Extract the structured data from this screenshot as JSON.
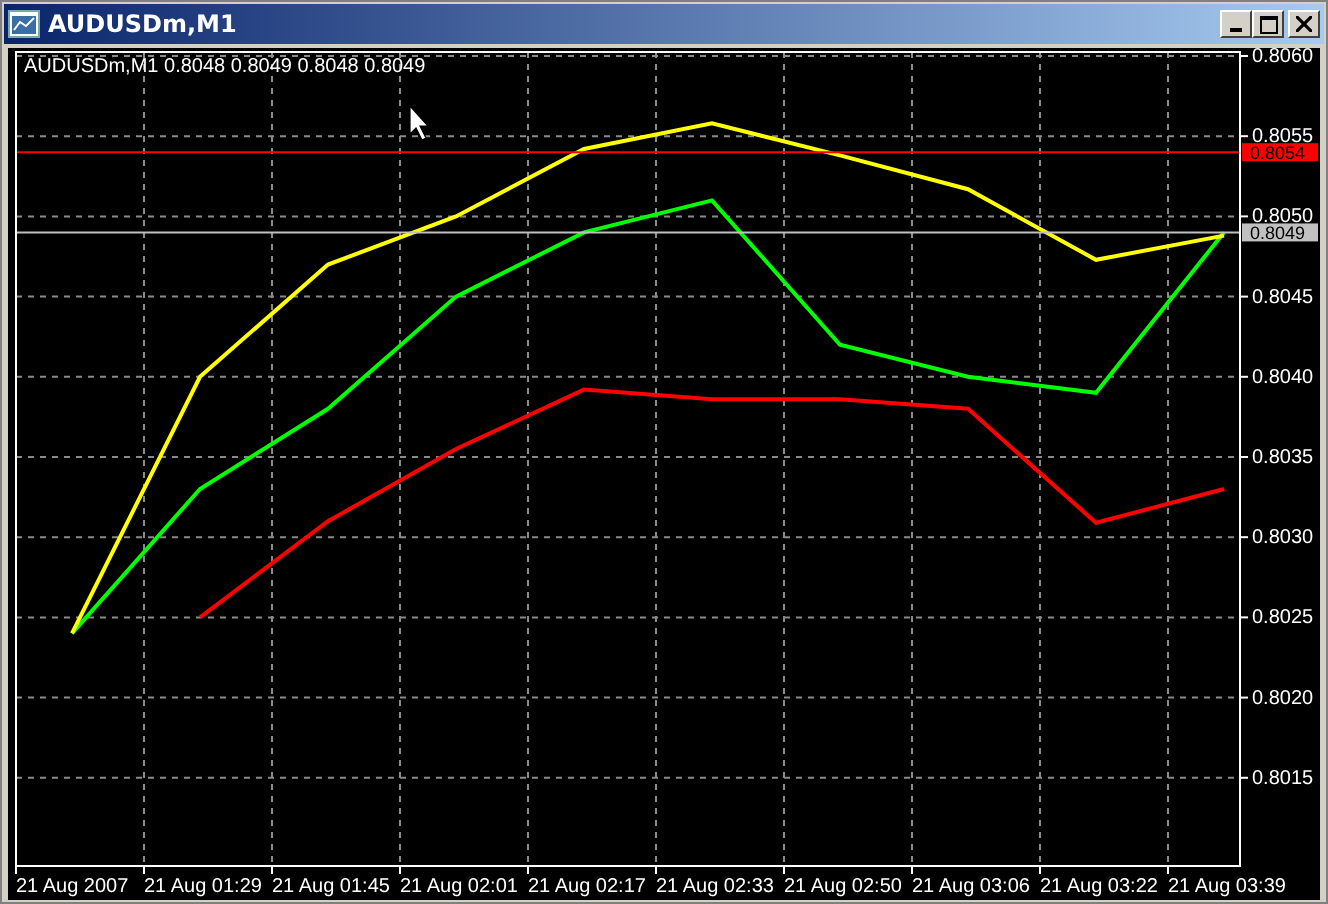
{
  "window": {
    "title": "AUDUSDm,M1"
  },
  "chart": {
    "header": "AUDUSDm,M1  0.8048 0.8049 0.8048 0.8049",
    "chart_data": {
      "type": "line",
      "grid": true,
      "categories": [
        "21 Aug 2007",
        "21 Aug 01:29",
        "21 Aug 01:45",
        "21 Aug 02:01",
        "21 Aug 02:17",
        "21 Aug 02:33",
        "21 Aug 02:50",
        "21 Aug 03:06",
        "21 Aug 03:22",
        "21 Aug 03:39"
      ],
      "series": [
        {
          "color": "#00ff00",
          "values": [
            0.8024,
            0.8033,
            0.8038,
            0.8045,
            0.8049,
            0.8051,
            0.8042,
            0.804,
            0.8039,
            0.8049
          ]
        },
        {
          "color": "#ffff00",
          "values": [
            0.8024,
            0.804,
            0.8047,
            0.805,
            0.80542,
            0.80558,
            0.80538,
            0.80517,
            0.80473,
            0.80488
          ]
        },
        {
          "color": "#ff0000",
          "values": [
            null,
            0.8025,
            0.8031,
            0.80355,
            0.80392,
            0.80386,
            0.80386,
            0.8038,
            0.80309,
            0.8033
          ]
        }
      ],
      "ref_lines": [
        {
          "axis": "y",
          "value": 0.8054,
          "label": "0.8054",
          "color": "#ff0000"
        },
        {
          "axis": "y",
          "value": 0.8049,
          "label": "0.8049",
          "color": "#c0c0c0"
        }
      ],
      "ylim": [
        0.80095,
        0.806
      ],
      "yticks": [
        {
          "value": 0.806,
          "label": "0.8060"
        },
        {
          "value": 0.8055,
          "label": "0.8055"
        },
        {
          "value": 0.805,
          "label": "0.8050"
        },
        {
          "value": 0.8045,
          "label": "0.8045"
        },
        {
          "value": 0.804,
          "label": "0.8040"
        },
        {
          "value": 0.8035,
          "label": "0.8035"
        },
        {
          "value": 0.803,
          "label": "0.8030"
        },
        {
          "value": 0.8025,
          "label": "0.8025"
        },
        {
          "value": 0.802,
          "label": "0.8020"
        },
        {
          "value": 0.8015,
          "label": "0.8015"
        }
      ]
    }
  }
}
